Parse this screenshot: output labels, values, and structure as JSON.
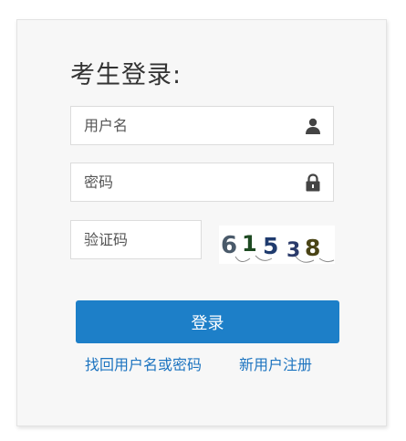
{
  "login": {
    "title": "考生登录:",
    "username_placeholder": "用户名",
    "password_placeholder": "密码",
    "captcha_placeholder": "验证码",
    "captcha_code": "61538",
    "submit_label": "登录",
    "forgot_link": "找回用户名或密码",
    "register_link": "新用户注册"
  },
  "icons": {
    "user": "user-icon",
    "password": "lock-icon"
  },
  "colors": {
    "primary": "#1d7fc8",
    "link": "#1d74c0"
  }
}
